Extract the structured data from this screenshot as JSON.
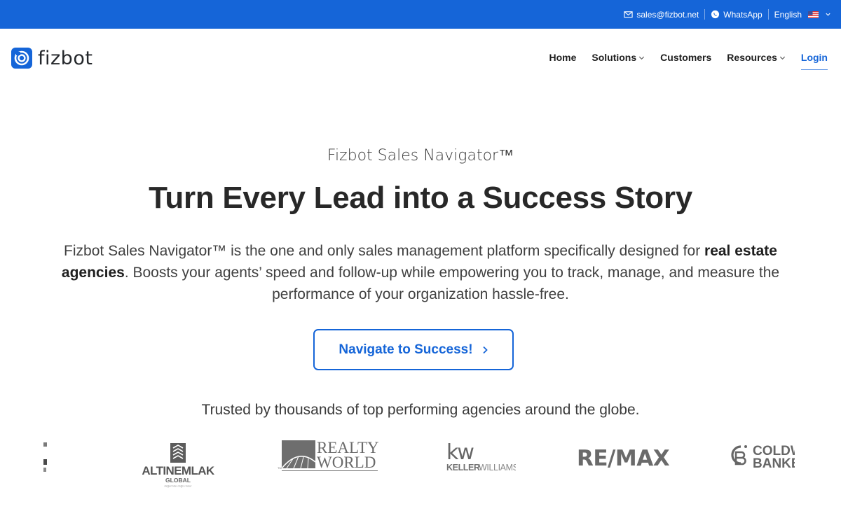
{
  "topbar": {
    "email": "sales@fizbot.net",
    "whatsapp": "WhatsApp",
    "language": "English",
    "bg_color": "#1565d8",
    "icons": [
      "mail-icon",
      "whatsapp-icon",
      "us-flag-icon",
      "chevron-down-icon"
    ]
  },
  "nav": {
    "logo_text": "fizbot",
    "items": [
      {
        "label": "Home",
        "has_dropdown": false
      },
      {
        "label": "Solutions",
        "has_dropdown": true
      },
      {
        "label": "Customers",
        "has_dropdown": false
      },
      {
        "label": "Resources",
        "has_dropdown": true
      }
    ],
    "login_label": "Login",
    "accent_color": "#1565d8"
  },
  "hero": {
    "eyebrow": "Fizbot Sales Navigator™",
    "headline": "Turn Every Lead into a Success Story",
    "lede_part1": "Fizbot Sales Navigator™ is the one and only sales management platform specifically designed for ",
    "lede_bold": "real estate agencies",
    "lede_part2": ". Boosts your agents’ speed and follow-up while empowering you to track, manage, and measure the performance of your organization hassle-free.",
    "cta_label": "Navigate to Success!",
    "trusted": "Trusted by thousands of top performing agencies around the globe."
  },
  "brands": {
    "altinemlak": {
      "name": "ALTINEMLAK",
      "sub": "GLOBAL",
      "tag": "değerinde doğru bulur"
    },
    "realtyworld": {
      "line1": "REALTY",
      "line2": "WORLD",
      "tm": "TM"
    },
    "kw": {
      "mark": "kw",
      "wordmark_a": "KELLER",
      "wordmark_b": "WILLIAMS"
    },
    "remax": {
      "name": "RE/MAX"
    },
    "coldwell": {
      "line1": "COLDW",
      "line2": "BANKE"
    }
  }
}
